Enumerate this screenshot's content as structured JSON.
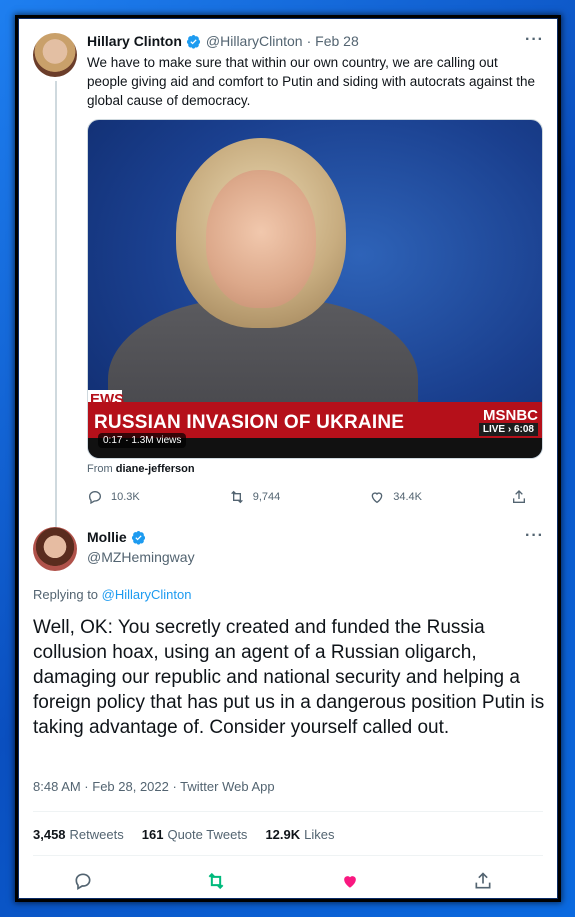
{
  "tweet1": {
    "name": "Hillary Clinton",
    "handle": "@HillaryClinton",
    "date": "· Feb 28",
    "text": "We have to make sure that within our own country, we are calling out people giving aid and comfort to Putin and siding with autocrats against the global cause of democracy.",
    "media": {
      "headline": "RUSSIAN INVASION OF UKRAINE",
      "ticker": "EWS",
      "network": "MSNBC",
      "live": "LIVE › 6:08",
      "views": "0:17 · 1.3M views"
    },
    "from_label": "From",
    "from_user": "diane-jefferson",
    "replies": "10.3K",
    "retweets": "9,744",
    "likes": "34.4K"
  },
  "tweet2": {
    "name": "Mollie",
    "handle": "@MZHemingway",
    "replying_label": "Replying to",
    "replying_to": "@HillaryClinton",
    "text": "Well, OK: You secretly created and funded the Russia collusion hoax, using an agent of a Russian oligarch, damaging our republic and national security and helping a foreign policy that has put us in a dangerous position Putin is taking advantage of. Consider yourself called out.",
    "meta": "8:48 AM · Feb 28, 2022 · Twitter Web App",
    "retweets_count": "3,458",
    "retweets_label": "Retweets",
    "quotes_count": "161",
    "quotes_label": "Quote Tweets",
    "likes_count": "12.9K",
    "likes_label": "Likes"
  },
  "colors": {
    "accent": "#1d9bf0",
    "retweet_green": "#00ba7c",
    "like_pink": "#f91880",
    "frame_blue": "#0a55c4"
  },
  "icons": [
    "verified-icon",
    "more-icon",
    "reply-icon",
    "retweet-icon",
    "like-icon",
    "share-icon"
  ]
}
